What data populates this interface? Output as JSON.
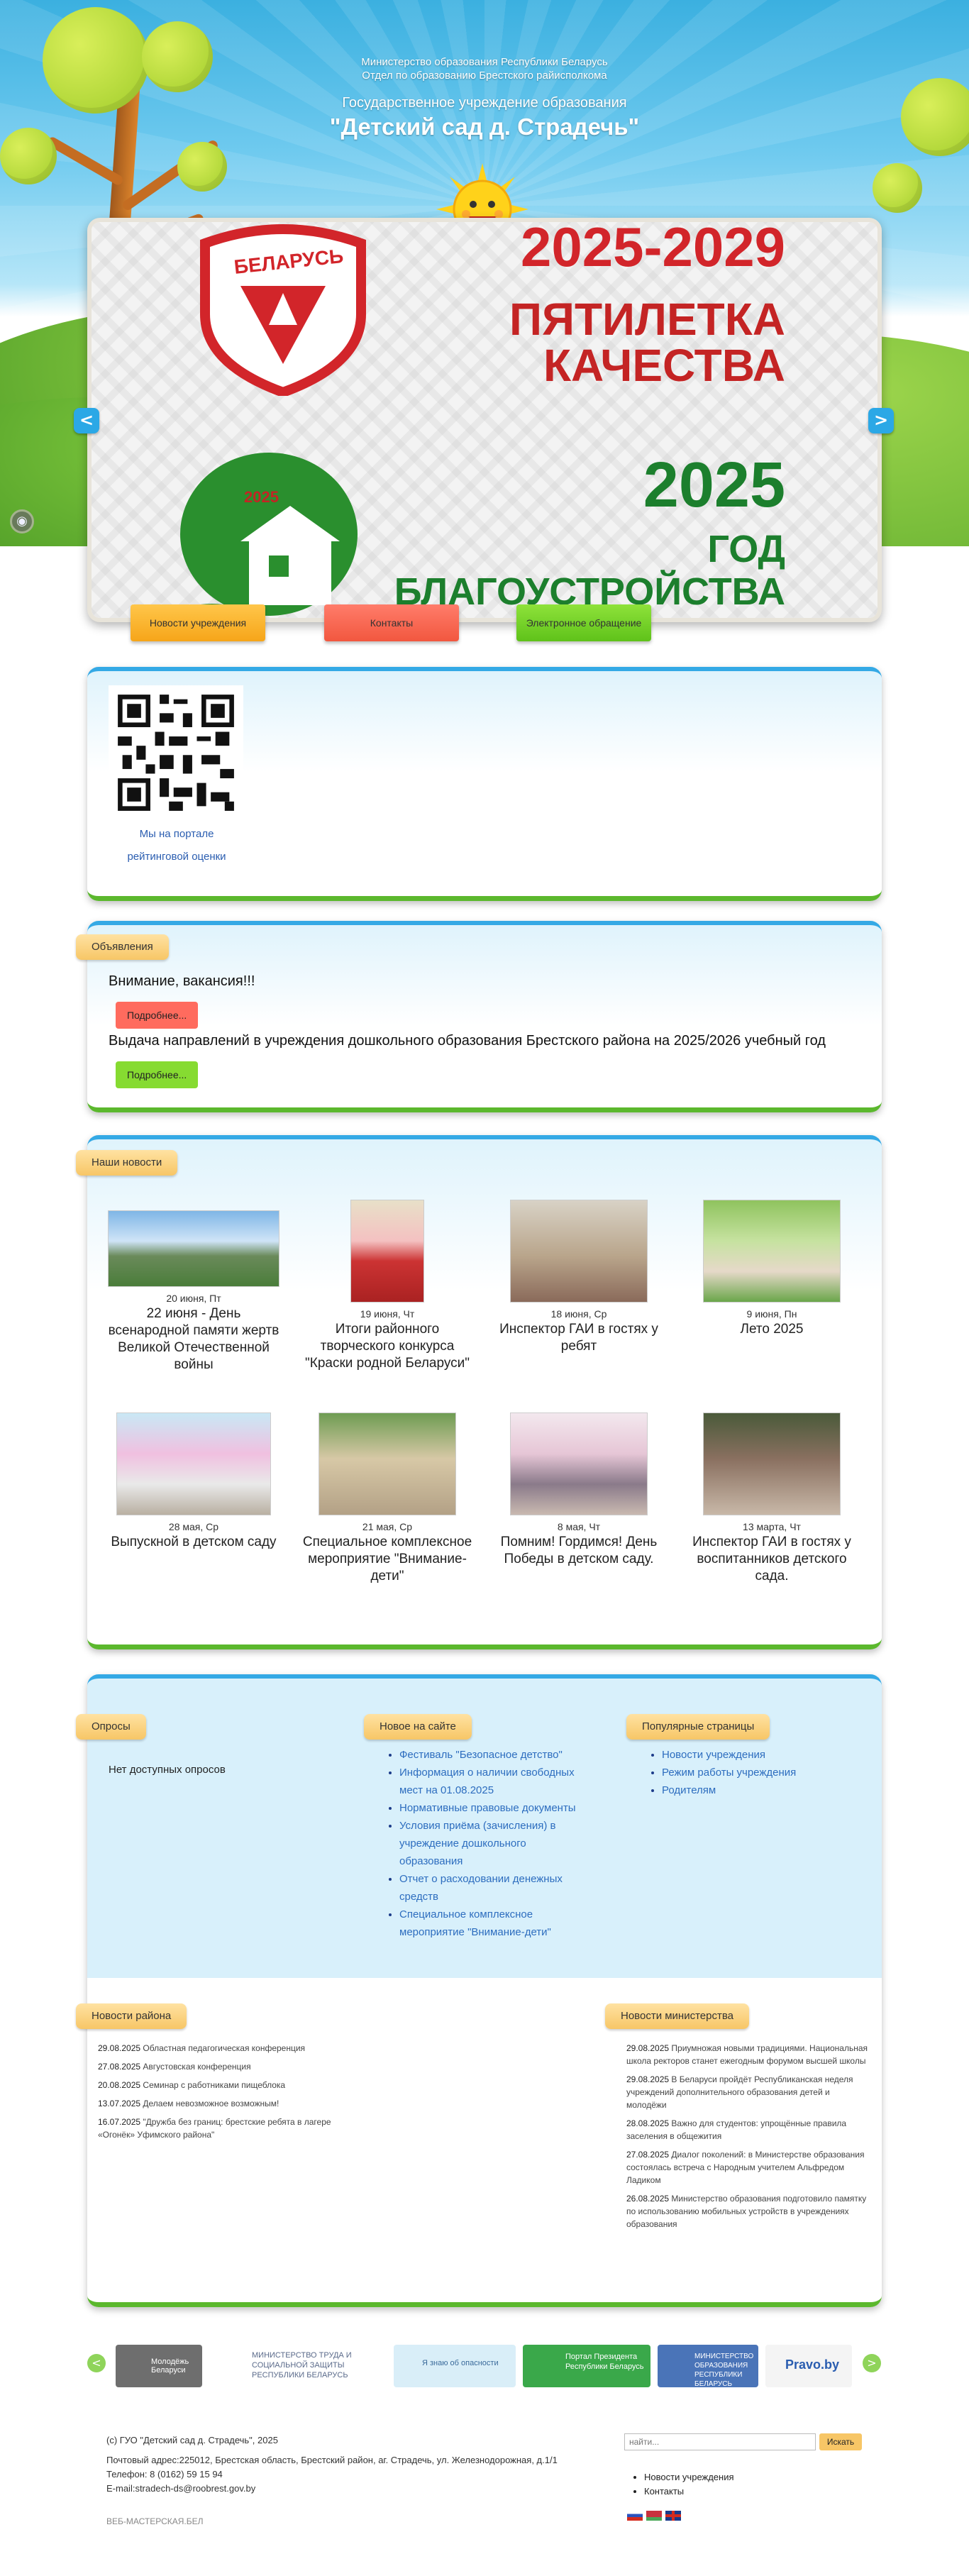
{
  "header": {
    "ministry": "Министерство образования Республики Беларусь",
    "department": "Отдел по образованию Брестского райисполкома",
    "inst_type": "Государственное учреждение образования",
    "inst_name": "\"Детский сад д. Страдечь\""
  },
  "slider": {
    "badge": "БЕЛАРУСЬ",
    "years": "2025-2029",
    "l1": "ПЯТИЛЕТКА",
    "l2": "КАЧЕСТВА",
    "year": "2025",
    "l3": "ГОД",
    "l4": "БЛАГОУСТРОЙСТВА",
    "logo_year": "2025",
    "prev": "<",
    "next": ">"
  },
  "nav": {
    "news": "Новости учреждения",
    "contacts": "Контакты",
    "appeal": "Электронное обращение"
  },
  "qr": {
    "l1": "Мы на портале",
    "l2": "рейтинговой оценки"
  },
  "ads": {
    "tag": "Объявления",
    "items": [
      {
        "title": "Внимание, вакансия!!!",
        "more": "Подробнее...",
        "color": "#ff6b5e"
      },
      {
        "title": "Выдача направлений в учреждения дошкольного образования Брестского района на 2025/2026 учебный год",
        "more": "Подробнее...",
        "color": "#86db31"
      }
    ]
  },
  "newsblock": {
    "tag": "Наши новости",
    "items": [
      {
        "date": "20 июня, Пт",
        "title": "22 июня - День всенародной памяти жертв Великой Отечественной войны"
      },
      {
        "date": "19 июня, Чт",
        "title": "Итоги районного творческого конкурса \"Краски родной Беларуси\""
      },
      {
        "date": "18 июня, Ср",
        "title": "Инспектор ГАИ в гостях у ребят"
      },
      {
        "date": "9 июня, Пн",
        "title": "Лето 2025"
      },
      {
        "date": "28 мая, Ср",
        "title": "Выпускной в детском саду"
      },
      {
        "date": "21 мая, Ср",
        "title": "Специальное комплексное мероприятие \"Внимание-дети\""
      },
      {
        "date": "8 мая, Чт",
        "title": "Помним! Гордимся! День Победы в детском саду."
      },
      {
        "date": "13 марта, Чт",
        "title": "Инспектор ГАИ в гостях у воспитанников детского сада."
      }
    ]
  },
  "polls": {
    "tag": "Опросы",
    "empty": "Нет доступных опросов"
  },
  "newsite": {
    "tag": "Новое на сайте",
    "items": [
      "Фестиваль \"Безопасное детство\"",
      "Информация о наличии свободных мест на 01.08.2025",
      "Нормативные правовые документы",
      "Условия приёма (зачисления) в учреждение дошкольного образования",
      "Отчет о расходовании денежных средств",
      "Специальное комплексное мероприятие \"Внимание-дети\""
    ]
  },
  "popular": {
    "tag": "Популярные страницы",
    "items": [
      "Новости учреждения",
      "Режим работы учреждения",
      "Родителям"
    ]
  },
  "district": {
    "tag": "Новости района",
    "items": [
      {
        "date": "29.08.2025",
        "text": "Областная педагогическая конференция"
      },
      {
        "date": "27.08.2025",
        "text": "Августовская конференция"
      },
      {
        "date": "20.08.2025",
        "text": "Семинар с работниками пищеблока"
      },
      {
        "date": "13.07.2025",
        "text": "Делаем невозможное возможным!"
      },
      {
        "date": "16.07.2025",
        "text": "\"Дружба без границ: брестские ребята в лагере «Огонёк» Уфимского района\""
      }
    ]
  },
  "ministry_news": {
    "tag": "Новости министерства",
    "items": [
      {
        "date": "29.08.2025",
        "text": "Приумножая новыми традициями. Национальная школа ректоров станет ежегодным форумом высшей школы"
      },
      {
        "date": "29.08.2025",
        "text": "В Беларуси пройдёт Республиканская неделя учреждений дополнительного образования детей и молодёжи"
      },
      {
        "date": "28.08.2025",
        "text": "Важно для студентов: упрощённые правила заселения в общежития"
      },
      {
        "date": "27.08.2025",
        "text": "Диалог поколений: в Министерстве образования состоялась встреча с Народным учителем Альфредом Ладиком"
      },
      {
        "date": "26.08.2025",
        "text": "Министерство образования подготовило памятку по использованию мобильных устройств в учреждениях образования"
      }
    ]
  },
  "partners": {
    "prev": "<",
    "next": ">",
    "items": [
      "Молодёжь Беларуси",
      "МИНИСТЕРСТВО ТРУДА И СОЦИАЛЬНОЙ ЗАЩИТЫ РЕСПУБЛИКИ БЕЛАРУСЬ",
      "Я знаю об опасности",
      "Портал Президента Республики Беларусь",
      "МИНИСТЕРСТВО ОБРАЗОВАНИЯ РЕСПУБЛИКИ БЕЛАРУСЬ",
      "Pravo.by"
    ]
  },
  "footer": {
    "copyright": "(c) ГУО \"Детский сад д. Страдечь\", 2025",
    "address": "Почтовый адрес:225012, Брестская область, Брестский район, аг. Страдечь, ул. Железнодорожная, д.1/1",
    "phone": "Телефон: 8 (0162) 59 15 94",
    "email": "E-mail:stradech-ds@roobrest.gov.by",
    "dev": "ВЕБ-МАСТЕРСКАЯ.БЕЛ",
    "search_placeholder": "найти...",
    "search_btn": "Искать",
    "links": [
      "Новости учреждения",
      "Контакты"
    ]
  },
  "colors": {
    "accent_blue": "#34a9e5",
    "accent_green": "#5bb82d",
    "tag_bg": "#f7c666",
    "section_bg": "#d8f0fb"
  }
}
